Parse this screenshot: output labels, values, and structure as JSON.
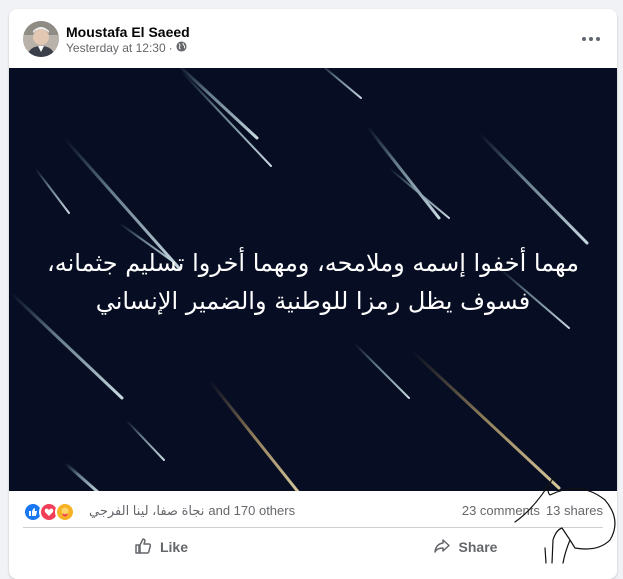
{
  "post": {
    "author": "Moustafa El Saeed",
    "timestamp": "Yesterday at 12:30",
    "separator": "·",
    "privacy_icon": "globe-icon",
    "menu_icon": "more-horizontal-icon",
    "text_line_1": "مهما أخفوا إسمه وملامحه، ومهما أخروا تسليم جثمانه،",
    "text_line_2": "فسوف يظل رمزا للوطنية والضمير الإنساني",
    "background_color": "#070d22"
  },
  "stats": {
    "reaction_icons": [
      "like-icon",
      "love-icon",
      "care-icon"
    ],
    "reaction_names": "نجاة صفا، لينا الفرجي",
    "reaction_others": "and 170 others",
    "comments": "23 comments",
    "shares": "13 shares"
  },
  "actions": {
    "like_label": "Like",
    "share_label": "Share"
  },
  "colors": {
    "like_blue": "#1877f2",
    "love_red": "#f33e58",
    "care_yellow": "#f7b125",
    "secondary_text": "#65676b"
  }
}
